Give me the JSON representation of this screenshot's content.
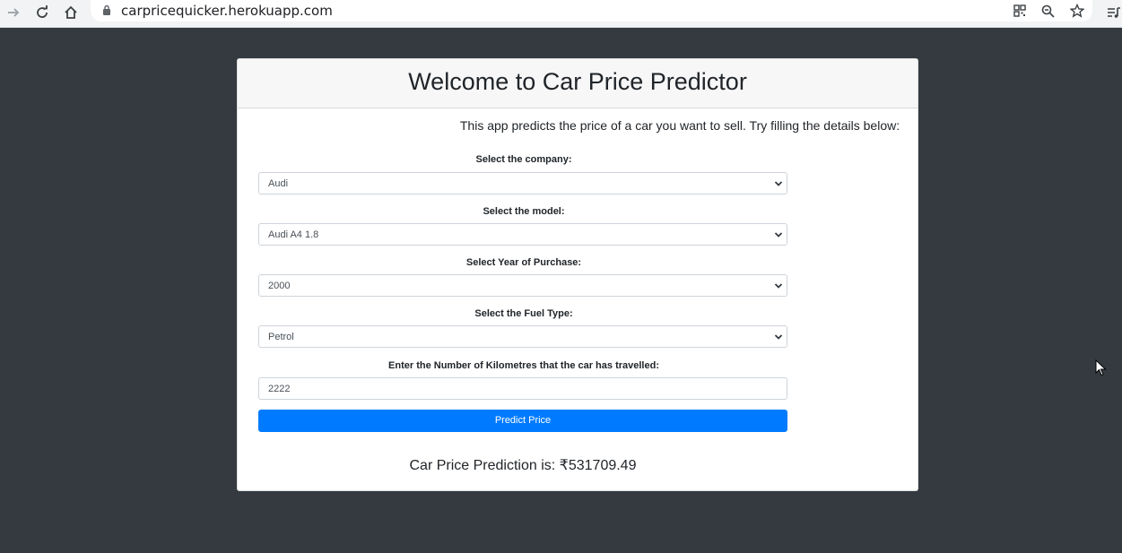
{
  "browser": {
    "url": "carpricequicker.herokuapp.com"
  },
  "card": {
    "title": "Welcome to Car Price Predictor",
    "intro": "This app predicts the price of a car you want to sell. Try filling the details below:"
  },
  "form": {
    "company": {
      "label": "Select the company:",
      "value": "Audi"
    },
    "model": {
      "label": "Select the model:",
      "value": "Audi A4 1.8"
    },
    "year": {
      "label": "Select Year of Purchase:",
      "value": "2000"
    },
    "fuel": {
      "label": "Select the Fuel Type:",
      "value": "Petrol"
    },
    "kms": {
      "label": "Enter the Number of Kilometres that the car has travelled:",
      "value": "2222"
    },
    "predict_label": "Predict Price"
  },
  "result": {
    "text": "Car Price Prediction is: ₹531709.49"
  },
  "colors": {
    "background": "#343a40",
    "primary": "#007bff",
    "card_header": "#f7f7f7"
  },
  "icons": {
    "forward": "forward-arrow-icon",
    "reload": "reload-icon",
    "home": "home-icon",
    "lock": "lock-icon",
    "qr": "qr-code-icon",
    "zoom": "zoom-out-icon",
    "bookmark": "star-icon",
    "media": "media-control-icon",
    "chevron": "chevron-down-icon",
    "cursor": "mouse-cursor-icon"
  }
}
